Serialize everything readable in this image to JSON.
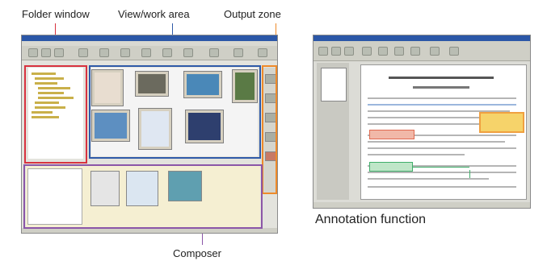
{
  "labels": {
    "folder_window": "Folder window",
    "view_work_area": "View/work area",
    "output_zone": "Output zone",
    "composer": "Composer",
    "annotation_function": "Annotation function"
  },
  "colors": {
    "folder_window": "#d8323f",
    "view_work_area": "#2f5aa8",
    "output_zone": "#ee8a2a",
    "composer": "#8b56a8",
    "note_orange": "#f0a040",
    "note_green": "#3fae6a",
    "note_red": "#e06a50"
  }
}
